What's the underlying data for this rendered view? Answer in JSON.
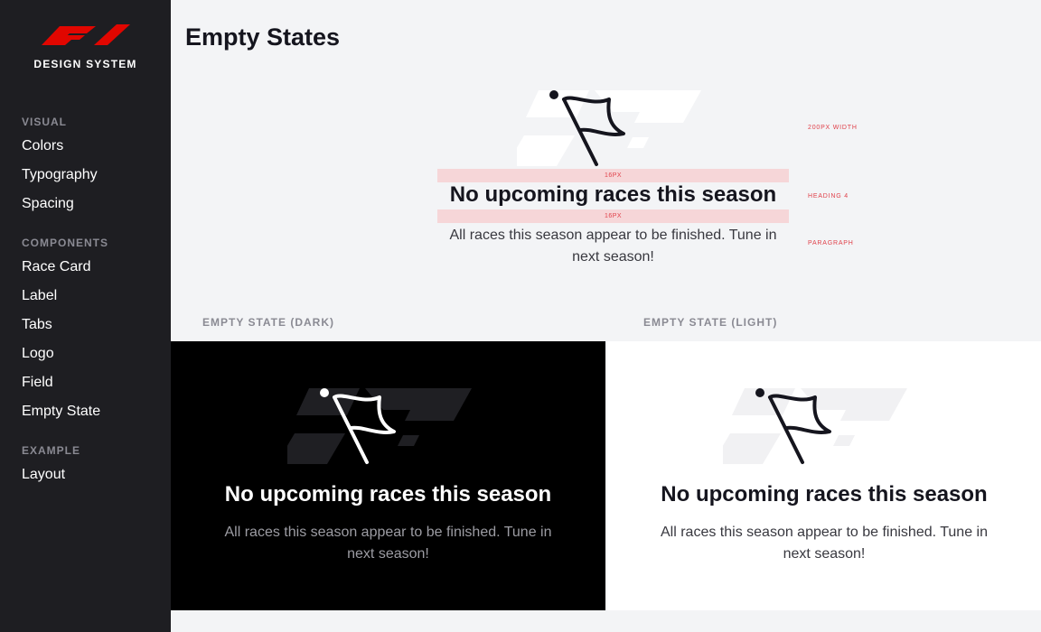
{
  "brand": {
    "logo_name": "f1-logo",
    "tagline": "DESIGN SYSTEM",
    "accent_color": "#e10600"
  },
  "sidebar": {
    "sections": [
      {
        "title": "VISUAL",
        "items": [
          "Colors",
          "Typography",
          "Spacing"
        ]
      },
      {
        "title": "COMPONENTS",
        "items": [
          "Race Card",
          "Label",
          "Tabs",
          "Logo",
          "Field",
          "Empty State"
        ]
      },
      {
        "title": "EXAMPLE",
        "items": [
          "Layout"
        ]
      }
    ]
  },
  "page": {
    "title": "Empty States"
  },
  "spec": {
    "spacing_top": "16PX",
    "spacing_bottom": "16PX",
    "heading": "No upcoming races this season",
    "paragraph": "All races this season appear to be finished. Tune in next season!",
    "annotations": {
      "width": "200PX WIDTH",
      "heading": "HEADING 4",
      "paragraph": "PARAGRAPH"
    }
  },
  "examples": {
    "dark": {
      "label": "EMPTY STATE (DARK)",
      "heading": "No upcoming races this season",
      "paragraph": "All races this season appear to be finished. Tune in next season!"
    },
    "light": {
      "label": "EMPTY STATE (LIGHT)",
      "heading": "No upcoming races this season",
      "paragraph": "All races this season appear to be finished. Tune in next season!"
    }
  },
  "icons": {
    "illustration": "flag-icon"
  }
}
